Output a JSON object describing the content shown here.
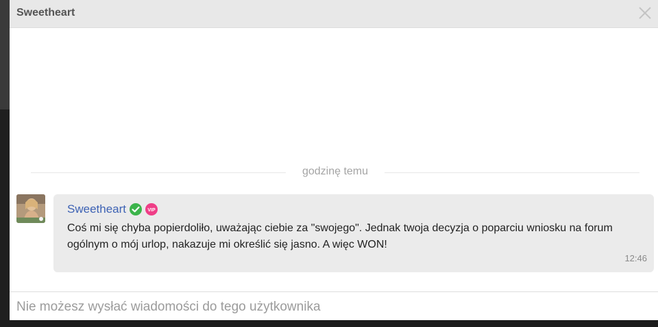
{
  "dialog": {
    "title": "Sweetheart",
    "close_icon": "close-icon"
  },
  "timeline": {
    "divider_label": "godzinę temu"
  },
  "message": {
    "sender": "Sweetheart",
    "verified_icon": "verified-check-icon",
    "vip_badge": "VIP",
    "text": "Coś mi się chyba popierdoliło, uważając ciebie za \"swojego\". Jednak twoja decyzja o poparciu wniosku na forum ogólnym o mój urlop, nakazuje mi określić się jasno. A więc WON!",
    "time": "12:46"
  },
  "footer": {
    "notice": "Nie możesz wysłać wiadomości do tego użytkownika"
  },
  "colors": {
    "sender_link": "#3d62b4",
    "verified_green": "#3cb44b",
    "vip_pink": "#ef3e87",
    "bubble_bg": "#ebebeb",
    "titlebar_bg": "#e8e8e8"
  }
}
